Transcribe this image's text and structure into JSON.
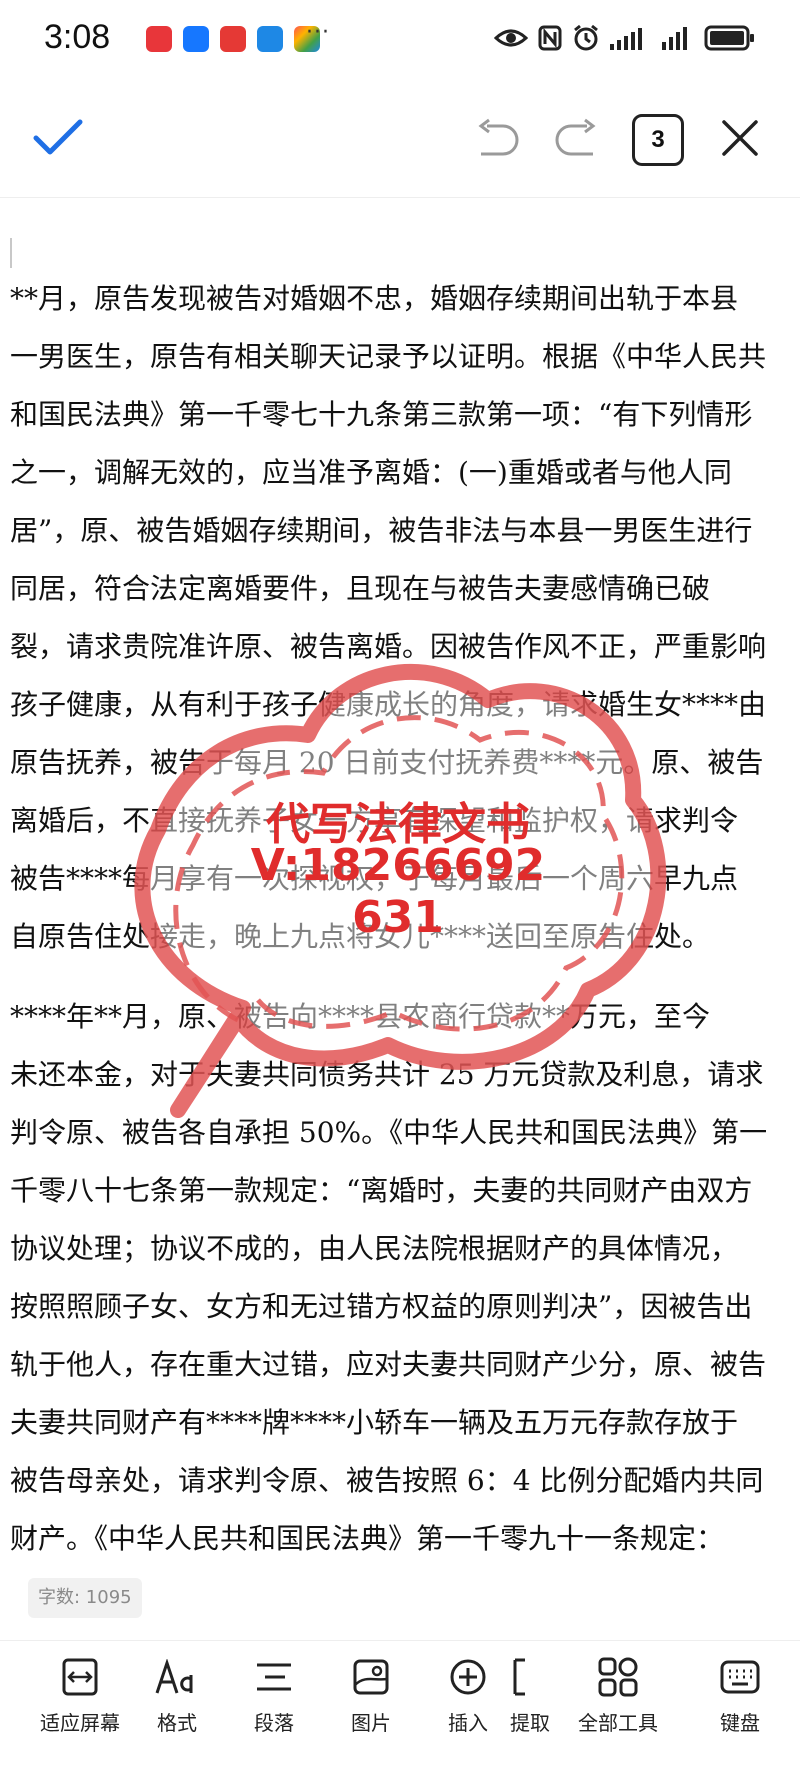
{
  "status_bar": {
    "time": "3:08",
    "more": "···",
    "app_icons": [
      {
        "name": "huawei-store-icon",
        "color": "#e8363a"
      },
      {
        "name": "alipay-icon",
        "color": "#1677ff"
      },
      {
        "name": "red-app-icon",
        "color": "#e53935"
      },
      {
        "name": "lightbulb-app-icon",
        "color": "#1e88e5"
      },
      {
        "name": "colorful-app-icon",
        "color": "#ff9800"
      }
    ],
    "right_icons": [
      "eye-icon",
      "nfc-icon",
      "alarm-icon",
      "signal-icon",
      "signal-icon",
      "battery-icon"
    ]
  },
  "toolbar": {
    "confirm_icon": "checkmark-icon",
    "undo_icon": "undo-icon",
    "redo_icon": "redo-icon",
    "page_count": "3",
    "close_icon": "close-icon",
    "accent_color": "#1f6fe5"
  },
  "document": {
    "lines": [
      "**月，原告发现被告对婚姻不忠，婚姻存续期间出轨于本县",
      "一男医生，原告有相关聊天记录予以证明。根据《中华人民共",
      "和国民法典》第一千零七十九条第三款第一项：“有下列情形",
      "之一，调解无效的，应当准予离婚：(一)重婚或者与他人同",
      "居”，原、被告婚姻存续期间，被告非法与本县一男医生进行",
      "同居，符合法定离婚要件，且现在与被告夫妻感情确已破",
      "裂，请求贵院准许原、被告离婚。因被告作风不正，严重影响",
      "孩子健康，从有利于孩子健康成长的角度，请求婚生女****由",
      "原告抚养，被告于每月 20 日前支付抚养费****元。原、被告",
      "离婚后，不直接抚养子女一方享有探望和监护权，请求判令",
      "被告****每月享有一次探视权，于每月最后一个周六早九点",
      "自原告住处接走，晚上九点将女儿****送回至原告住处。",
      "        ****年**月，原、被告向****县农商行贷款**万元，至今",
      "未还本金，对于夫妻共同债务共计 25 万元贷款及利息，请求",
      "判令原、被告各自承担 50%。《中华人民共和国民法典》第一",
      "千零八十七条第一款规定：“离婚时，夫妻的共同财产由双方",
      "协议处理；协议不成的，由人民法院根据财产的具体情况，",
      "按照照顾子女、女方和无过错方权益的原则判决”，因被告出",
      "轨于他人，存在重大过错，应对夫妻共同财产少分，原、被告",
      "夫妻共同财产有****牌****小轿车一辆及五万元存款存放于",
      "被告母亲处，请求判令原、被告按照 6：4 比例分配婚内共同",
      "财产。《中华人民共和国民法典》第一千零九十一条规定："
    ]
  },
  "stamp": {
    "line1": "代写法律文书",
    "line2": "V:18266692",
    "line3": "631",
    "color": "#e02c2c"
  },
  "word_count": "字数: 1095",
  "bottom_bar": {
    "items": [
      {
        "icon": "fit-screen-icon",
        "label": "适应屏幕"
      },
      {
        "icon": "format-icon",
        "label": "格式"
      },
      {
        "icon": "paragraph-icon",
        "label": "段落"
      },
      {
        "icon": "image-icon",
        "label": "图片"
      },
      {
        "icon": "insert-icon",
        "label": "插入"
      },
      {
        "icon": "extract-icon",
        "label": "提取"
      },
      {
        "icon": "all-tools-icon",
        "label": "全部工具"
      },
      {
        "icon": "keyboard-icon",
        "label": "键盘"
      }
    ]
  }
}
